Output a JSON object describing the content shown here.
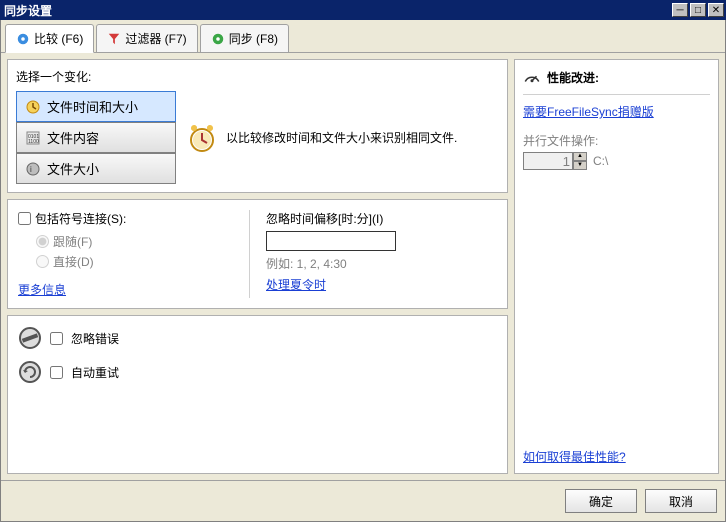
{
  "window": {
    "title": "同步设置"
  },
  "tabs": {
    "compare": "比较 (F6)",
    "filter": "过滤器 (F7)",
    "sync": "同步 (F8)"
  },
  "left": {
    "select_label": "选择一个变化:",
    "variant1": "文件时间和大小",
    "variant2": "文件内容",
    "variant3": "文件大小",
    "desc": "以比较修改时间和文件大小来识别相同文件.",
    "symlinks_label": "包括符号连接(S):",
    "follow": "跟随(F)",
    "direct": "直接(D)",
    "more_info": "更多信息",
    "offset_label": "忽略时间偏移[时:分](I)",
    "offset_value": "",
    "offset_example": "例如: 1, 2, 4:30",
    "handle_dst": "处理夏令时",
    "ignore_errors": "忽略错误",
    "auto_retry": "自动重试"
  },
  "right": {
    "perf_title": "性能改进:",
    "need_donation": "需要FreeFileSync捐赠版",
    "parallel_label": "并行文件操作:",
    "parallel_value": "1",
    "parallel_path": "C:\\",
    "best_perf_link": "如何取得最佳性能?"
  },
  "footer": {
    "ok": "确定",
    "cancel": "取消"
  }
}
